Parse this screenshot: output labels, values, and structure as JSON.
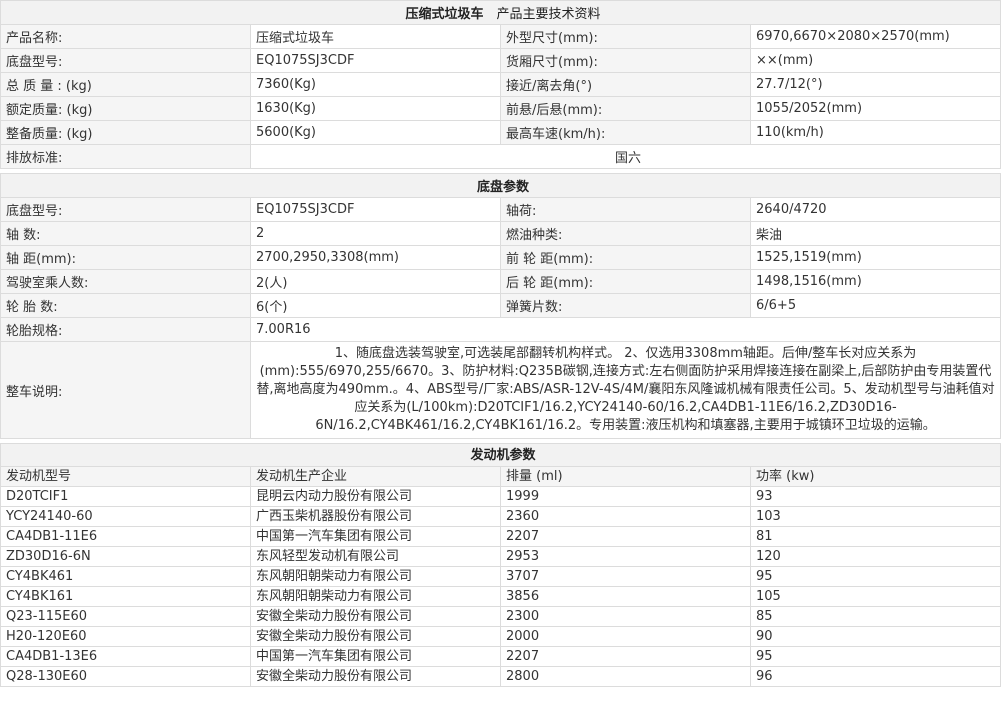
{
  "main_section": {
    "title_bold": "压缩式垃圾车",
    "title_rest": "　产品主要技术资料",
    "rows": [
      {
        "l1": "产品名称:",
        "v1": "压缩式垃圾车",
        "l2": "外型尺寸(mm):",
        "v2": "6970,6670×2080×2570(mm)"
      },
      {
        "l1": "底盘型号:",
        "v1": "EQ1075SJ3CDF",
        "l2": "货厢尺寸(mm):",
        "v2": "××(mm)"
      },
      {
        "l1": "总 质 量 : (kg)",
        "v1": "7360(Kg)",
        "l2": "接近/离去角(°)",
        "v2": "27.7/12(°)"
      },
      {
        "l1": "额定质量: (kg)",
        "v1": "1630(Kg)",
        "l2": "前悬/后悬(mm):",
        "v2": "1055/2052(mm)"
      },
      {
        "l1": "整备质量: (kg)",
        "v1": "5600(Kg)",
        "l2": "最高车速(km/h):",
        "v2": "110(km/h)"
      }
    ],
    "emission_label": "排放标准:",
    "emission_value": "国六"
  },
  "chassis_section": {
    "title": "底盘参数",
    "rows": [
      {
        "l1": "底盘型号:",
        "v1": "EQ1075SJ3CDF",
        "l2": "轴荷:",
        "v2": "2640/4720"
      },
      {
        "l1": "轴 数:",
        "v1": "2",
        "l2": "燃油种类:",
        "v2": "柴油"
      },
      {
        "l1": "轴 距(mm):",
        "v1": "2700,2950,3308(mm)",
        "l2": "前 轮 距(mm):",
        "v2": "1525,1519(mm)"
      },
      {
        "l1": "驾驶室乘人数:",
        "v1": "2(人)",
        "l2": "后 轮 距(mm):",
        "v2": "1498,1516(mm)"
      },
      {
        "l1": "轮 胎 数:",
        "v1": "6(个)",
        "l2": "弹簧片数:",
        "v2": "6/6+5"
      }
    ],
    "tire_label": "轮胎规格:",
    "tire_value": "7.00R16",
    "notes_label": "整车说明:",
    "notes_text": "1、随底盘选装驾驶室,可选装尾部翻转机构样式。 2、仅选用3308mm轴距。后伸/整车长对应关系为(mm):555/6970,255/6670。3、防护材料:Q235B碳钢,连接方式:左右侧面防护采用焊接连接在副梁上,后部防护由专用装置代替,离地高度为490mm.。4、ABS型号/厂家:ABS/ASR-12V-4S/4M/襄阳东风隆诚机械有限责任公司。5、发动机型号与油耗值对应关系为(L/100km):D20TCIF1/16.2,YCY24140-60/16.2,CA4DB1-11E6/16.2,ZD30D16-6N/16.2,CY4BK461/16.2,CY4BK161/16.2。专用装置:液压机构和填塞器,主要用于城镇环卫垃圾的运输。"
  },
  "engine_section": {
    "title": "发动机参数",
    "headers": [
      "发动机型号",
      "发动机生产企业",
      "排量 (ml)",
      "功率 (kw)"
    ],
    "rows": [
      [
        "D20TCIF1",
        "昆明云内动力股份有限公司",
        "1999",
        "93"
      ],
      [
        "YCY24140-60",
        "广西玉柴机器股份有限公司",
        "2360",
        "103"
      ],
      [
        "CA4DB1-11E6",
        "中国第一汽车集团有限公司",
        "2207",
        "81"
      ],
      [
        "ZD30D16-6N",
        "东风轻型发动机有限公司",
        "2953",
        "120"
      ],
      [
        "CY4BK461",
        "东风朝阳朝柴动力有限公司",
        "3707",
        "95"
      ],
      [
        "CY4BK161",
        "东风朝阳朝柴动力有限公司",
        "3856",
        "105"
      ],
      [
        "Q23-115E60",
        "安徽全柴动力股份有限公司",
        "2300",
        "85"
      ],
      [
        "H20-120E60",
        "安徽全柴动力股份有限公司",
        "2000",
        "90"
      ],
      [
        "CA4DB1-13E6",
        "中国第一汽车集团有限公司",
        "2207",
        "95"
      ],
      [
        "Q28-130E60",
        "安徽全柴动力股份有限公司",
        "2800",
        "96"
      ]
    ]
  }
}
